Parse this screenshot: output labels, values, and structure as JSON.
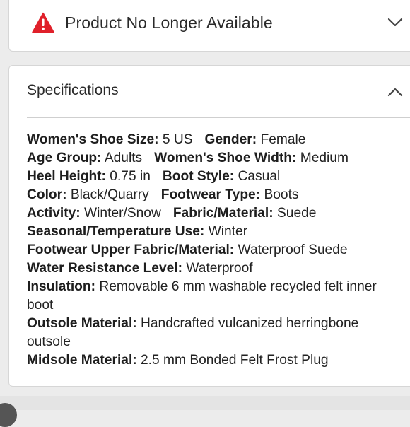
{
  "alert": {
    "icon": "warning-triangle-icon",
    "icon_color": "#e0202a",
    "text": "Product No Longer Available"
  },
  "specifications": {
    "title": "Specifications",
    "rows": [
      [
        {
          "label": "Women's Shoe Size:",
          "value": "5 US"
        },
        {
          "label": "Gender:",
          "value": "Female"
        }
      ],
      [
        {
          "label": "Age Group:",
          "value": "Adults"
        },
        {
          "label": "Women's Shoe Width:",
          "value": "Medium"
        }
      ],
      [
        {
          "label": "Heel Height:",
          "value": "0.75 in"
        },
        {
          "label": "Boot Style:",
          "value": "Casual"
        }
      ],
      [
        {
          "label": "Color:",
          "value": "Black/Quarry"
        },
        {
          "label": "Footwear Type:",
          "value": "Boots"
        }
      ],
      [
        {
          "label": "Activity:",
          "value": "Winter/Snow"
        },
        {
          "label": "Fabric/Material:",
          "value": "Suede"
        }
      ],
      [
        {
          "label": "Seasonal/Temperature Use:",
          "value": "Winter"
        }
      ],
      [
        {
          "label": "Footwear Upper Fabric/Material:",
          "value": "Waterproof Suede"
        }
      ],
      [
        {
          "label": "Water Resistance Level:",
          "value": "Waterproof"
        }
      ],
      [
        {
          "label": "Insulation:",
          "value": "Removable 6 mm washable recycled felt inner boot"
        }
      ],
      [
        {
          "label": "Outsole Material:",
          "value": "Handcrafted vulcanized herringbone outsole"
        }
      ],
      [
        {
          "label": "Midsole Material:",
          "value": "2.5 mm Bonded Felt Frost Plug"
        }
      ]
    ]
  }
}
